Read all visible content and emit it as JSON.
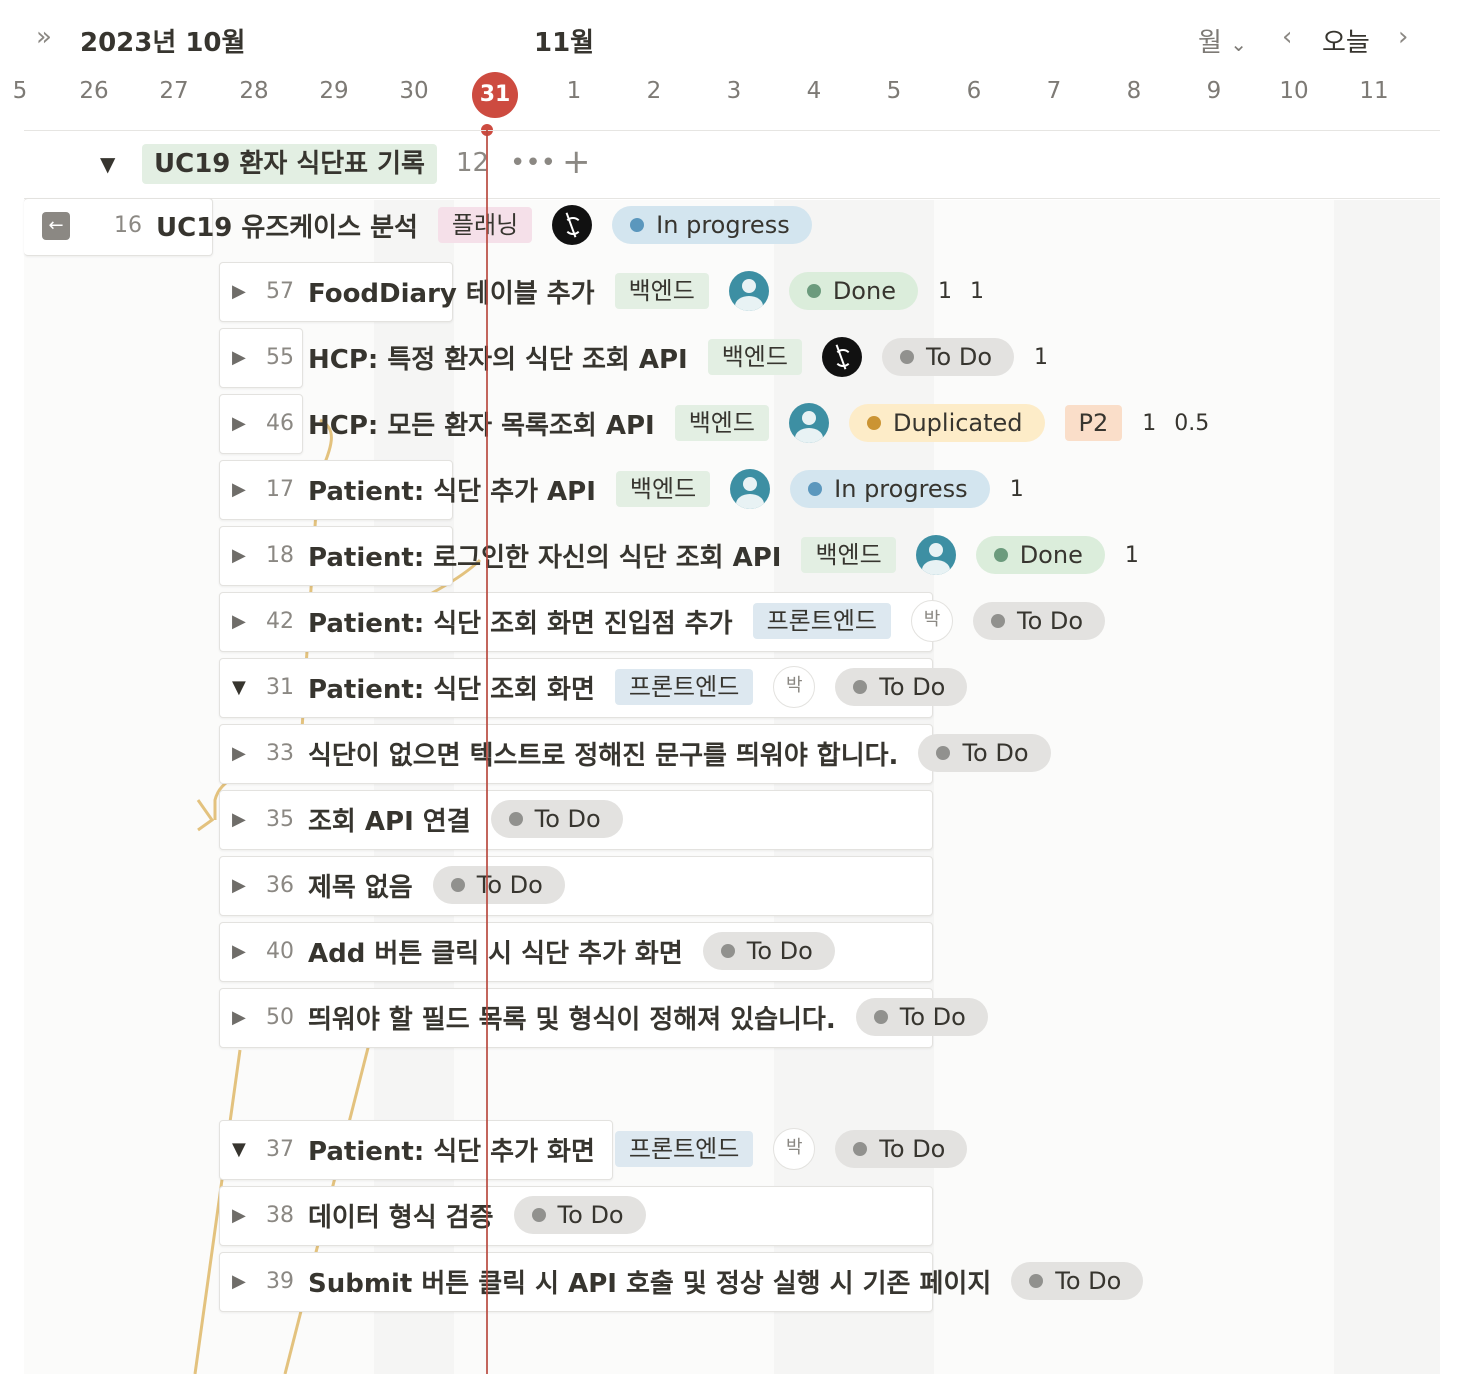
{
  "header": {
    "expand_icon": "double-chevron-right-icon",
    "month_left": "2023년 10월",
    "month_right": "11월",
    "view_select": "월",
    "today_button": "오늘"
  },
  "dates": [
    "5",
    "26",
    "27",
    "28",
    "29",
    "30",
    "31",
    "1",
    "2",
    "3",
    "4",
    "5",
    "6",
    "7",
    "8",
    "9",
    "10",
    "11"
  ],
  "today": "31",
  "group": {
    "title": "UC19 환자 식단표 기록",
    "count": "12",
    "more": "•••",
    "add": "+"
  },
  "parent_row": {
    "num": "16",
    "title": "UC19 유즈케이스 분석",
    "tag": "플래닝",
    "status": "In progress"
  },
  "rows": [
    {
      "num": "57",
      "title": "FoodDiary 테이블 추가",
      "tag": "백엔드",
      "status": "Done",
      "e1": "1",
      "e2": "1"
    },
    {
      "num": "55",
      "title": "HCP: 특정 환자의 식단 조회 API",
      "tag": "백엔드",
      "status": "To Do",
      "e1": "1"
    },
    {
      "num": "46",
      "title": "HCP: 모든 환자 목록조회 API",
      "tag": "백엔드",
      "status": "Duplicated",
      "priority": "P2",
      "e1": "1",
      "e2": "0.5"
    },
    {
      "num": "17",
      "title": "Patient: 식단 추가 API",
      "tag": "백엔드",
      "status": "In progress",
      "e1": "1"
    },
    {
      "num": "18",
      "title": "Patient: 로그인한 자신의 식단 조회 API",
      "tag": "백엔드",
      "status": "Done",
      "e1": "1"
    },
    {
      "num": "42",
      "title": "Patient: 식단 조회 화면 진입점 추가",
      "tag": "프론트엔드",
      "avatar": "박",
      "status": "To Do"
    },
    {
      "num": "31",
      "title": "Patient: 식단 조회 화면",
      "tag": "프론트엔드",
      "avatar": "박",
      "status": "To Do"
    },
    {
      "num": "33",
      "title": "식단이 없으면 텍스트로 정해진 문구를 띄워야 합니다.",
      "status": "To Do"
    },
    {
      "num": "35",
      "title": "조회 API 연결",
      "status": "To Do"
    },
    {
      "num": "36",
      "title": "제목 없음",
      "status": "To Do"
    },
    {
      "num": "40",
      "title": "Add 버튼 클릭 시 식단 추가 화면",
      "status": "To Do"
    },
    {
      "num": "50",
      "title": "띄워야 할 필드 목록 및 형식이 정해져 있습니다.",
      "status": "To Do"
    },
    {
      "num": "37",
      "title": "Patient: 식단 추가 화면",
      "tag": "프론트엔드",
      "avatar": "박",
      "status": "To Do"
    },
    {
      "num": "38",
      "title": "데이터 형식 검증",
      "status": "To Do"
    },
    {
      "num": "39",
      "title": "Submit 버튼 클릭 시 API 호출 및 정상 실행 시 기존 페이지",
      "status": "To Do"
    }
  ],
  "colors": {
    "today": "#cd4b40",
    "backend_tag": "#e3efe3",
    "frontend_tag": "#dde8f0",
    "planning_tag": "#f5e0e9",
    "priority_tag": "#fadec9",
    "status_todo": "#e3e2e0",
    "status_done": "#dbeddb",
    "status_inprogress": "#d3e5ef",
    "status_duplicated": "#fdecc8",
    "dependency_line": "#e3c27e"
  }
}
